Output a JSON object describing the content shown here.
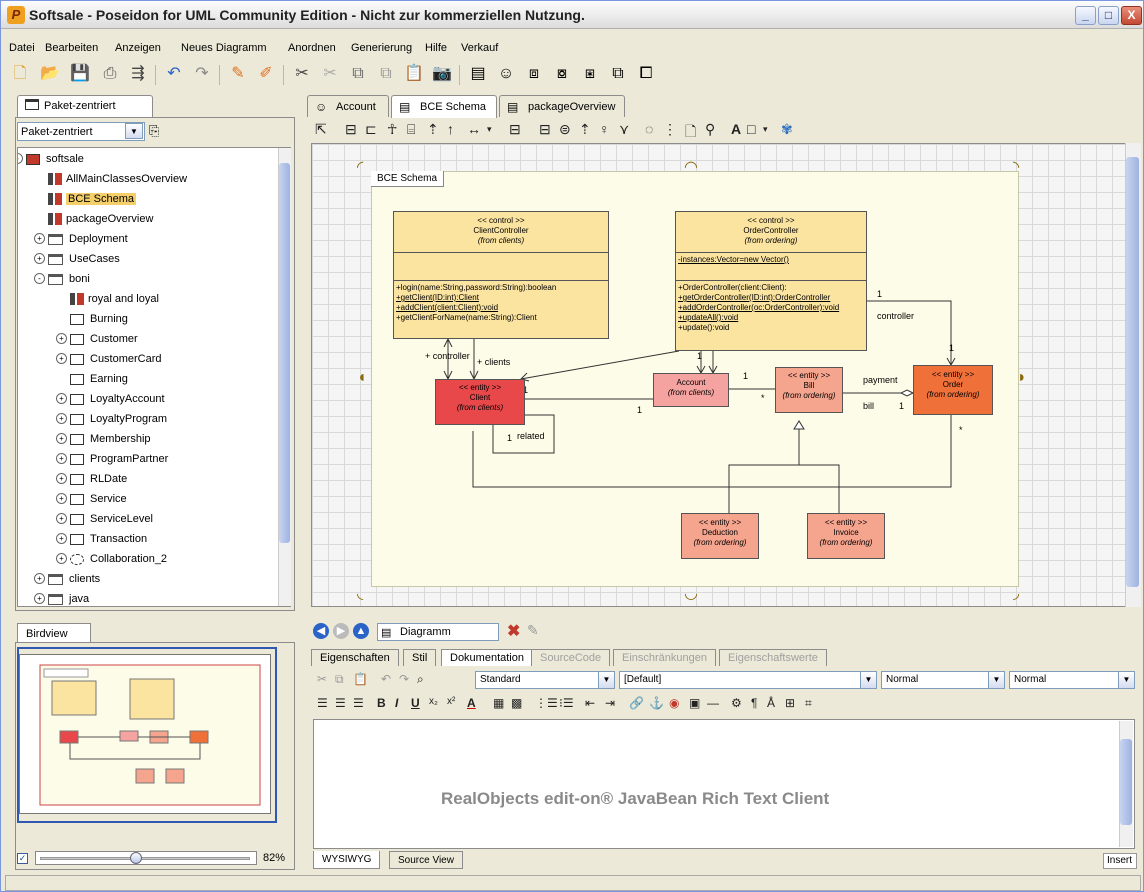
{
  "window": {
    "title": "Softsale - Poseidon for UML Community Edition - Nicht zur kommerziellen Nutzung.",
    "min": "_",
    "max": "□",
    "close": "X"
  },
  "menu": [
    "Datei",
    "Bearbeiten",
    "Anzeigen",
    "Neues Diagramm",
    "Anordnen",
    "Generierung",
    "Hilfe",
    "Verkauf"
  ],
  "left_panel": {
    "tab": "Paket-zentriert",
    "selector_value": "Paket-zentriert",
    "tree": [
      {
        "label": "softsale",
        "type": "root"
      },
      {
        "label": "AllMainClassesOverview",
        "type": "diagram"
      },
      {
        "label": "BCE Schema",
        "type": "diagram",
        "selected": true
      },
      {
        "label": "packageOverview",
        "type": "diagram"
      },
      {
        "label": "Deployment",
        "type": "folder"
      },
      {
        "label": "UseCases",
        "type": "folder"
      },
      {
        "label": "boni",
        "type": "folder"
      },
      {
        "label": "royal and loyal",
        "type": "diagram"
      },
      {
        "label": "Burning",
        "type": "class"
      },
      {
        "label": "Customer",
        "type": "class"
      },
      {
        "label": "CustomerCard",
        "type": "class"
      },
      {
        "label": "Earning",
        "type": "class"
      },
      {
        "label": "LoyaltyAccount",
        "type": "class"
      },
      {
        "label": "LoyaltyProgram",
        "type": "class"
      },
      {
        "label": "Membership",
        "type": "class"
      },
      {
        "label": "ProgramPartner",
        "type": "class"
      },
      {
        "label": "RLDate",
        "type": "class"
      },
      {
        "label": "Service",
        "type": "class"
      },
      {
        "label": "ServiceLevel",
        "type": "class"
      },
      {
        "label": "Transaction",
        "type": "class"
      },
      {
        "label": "Collaboration_2",
        "type": "collab"
      },
      {
        "label": "clients",
        "type": "folder"
      },
      {
        "label": "java",
        "type": "folder"
      }
    ]
  },
  "birdview": {
    "tab": "Birdview",
    "zoom": "82%",
    "zoom_level": 0.45
  },
  "diagram_tabs": [
    "Account",
    "BCE Schema",
    "packageOverview"
  ],
  "active_diagram_tab": "BCE Schema",
  "diagram": {
    "label": "BCE Schema",
    "classes": {
      "clientcontroller": {
        "stereo": "<< control >>",
        "name": "ClientController",
        "from": "(from clients)",
        "ops": [
          "+login(name:String,password:String):boolean",
          "+getClient(ID:int):Client",
          "+addClient(client:Client):void",
          "+getClientForName(name:String):Client"
        ]
      },
      "ordercontroller": {
        "stereo": "<< control >>",
        "name": "OrderController",
        "from": "(from ordering)",
        "attr": "-instances:Vector=new Vector()",
        "ops": [
          "+OrderController(client:Client):",
          "+getOrderController(ID:int):OrderController",
          "+addOrderController(oc:OrderController):void",
          "+updateAll():void",
          "+update():void"
        ]
      },
      "client": {
        "stereo": "<< entity >>",
        "name": "Client",
        "from": "(from clients)"
      },
      "account": {
        "name": "Account",
        "from": "(from clients)"
      },
      "bill": {
        "stereo": "<< entity >>",
        "name": "Bill",
        "from": "(from ordering)"
      },
      "order": {
        "stereo": "<< entity >>",
        "name": "Order",
        "from": "(from ordering)"
      },
      "deduction": {
        "stereo": "<< entity >>",
        "name": "Deduction",
        "from": "(from ordering)"
      },
      "invoice": {
        "stereo": "<< entity >>",
        "name": "Invoice",
        "from": "(from ordering)"
      }
    },
    "labels": {
      "controller_l": "+ controller",
      "clients": "+ clients",
      "related": "related",
      "controller_r": "controller",
      "payment": "payment",
      "bill": "bill",
      "one": "1",
      "many": "*"
    }
  },
  "nav": {
    "selector": "Diagramm"
  },
  "props_tabs": [
    "Eigenschaften",
    "Stil",
    "Dokumentation",
    "SourceCode",
    "Einschränkungen",
    "Eigenschaftswerte"
  ],
  "active_props_tab": "Dokumentation",
  "editor": {
    "style": "Standard",
    "font": "[Default]",
    "size1": "Normal",
    "size2": "Normal",
    "placeholder_text": "RealObjects edit-on® JavaBean Rich Text Client",
    "tabs": [
      "WYSIWYG",
      "Source View"
    ],
    "mode": "Insert"
  },
  "colors": {
    "control": "#fbe3a0",
    "entity_red": "#e9484b",
    "entity_salmon": "#f5a48e",
    "entity_orange": "#f0703a",
    "account": "#f4a3a0",
    "selection": "#f4cf6a"
  }
}
